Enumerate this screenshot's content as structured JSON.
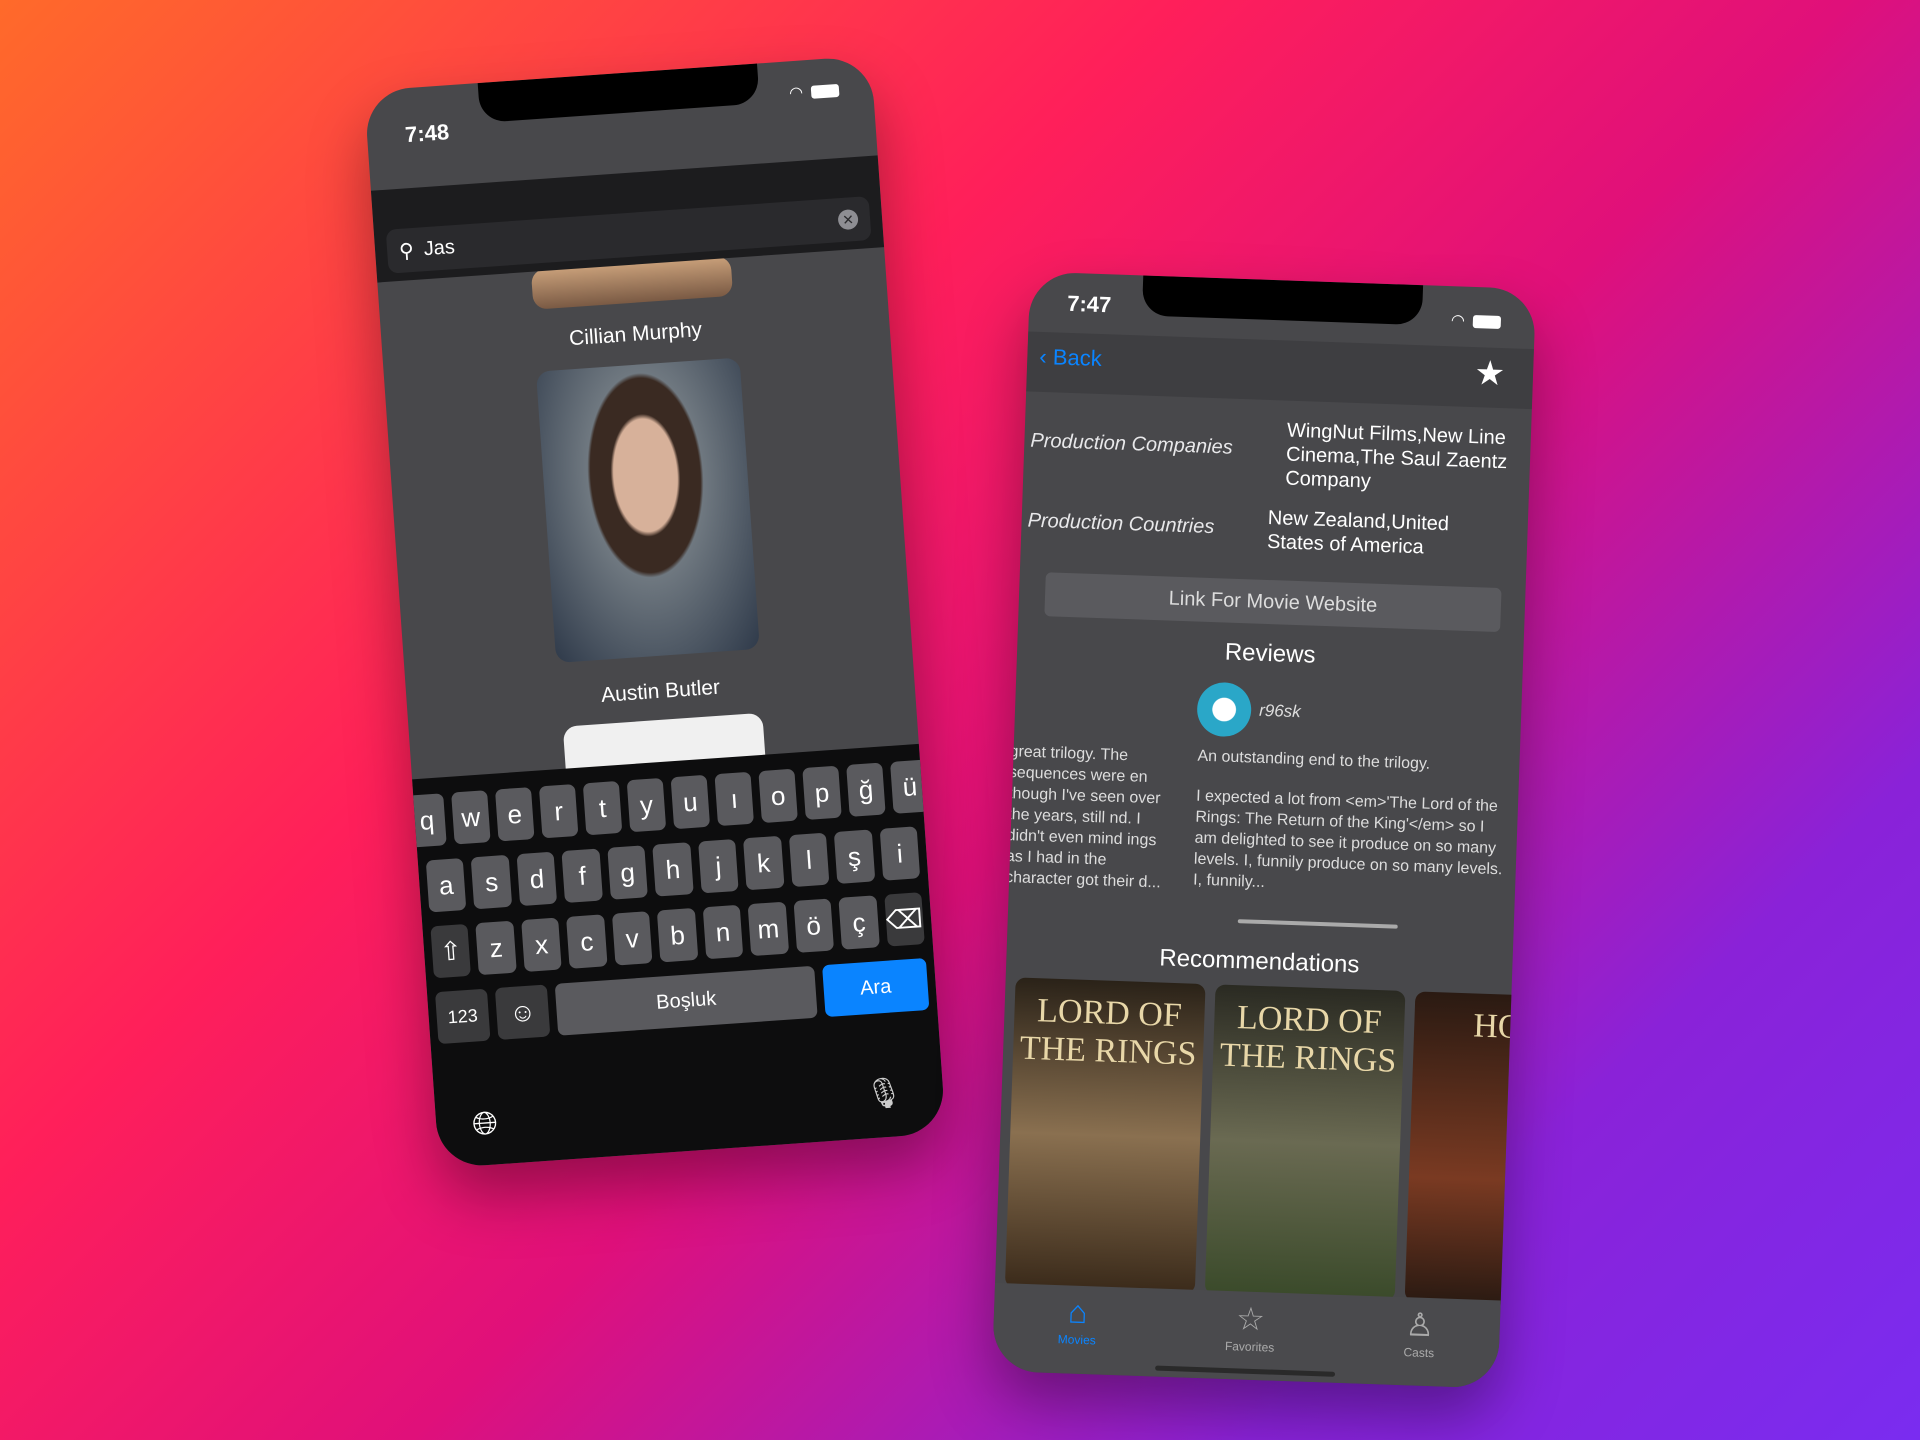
{
  "left_phone": {
    "time": "7:48",
    "search": {
      "value": "Jas"
    },
    "casts": [
      {
        "name": "Cillian Murphy"
      },
      {
        "name": "Austin Butler"
      }
    ],
    "keyboard": {
      "row1": [
        "q",
        "w",
        "e",
        "r",
        "t",
        "y",
        "u",
        "ı",
        "o",
        "p",
        "ğ",
        "ü"
      ],
      "row2": [
        "a",
        "s",
        "d",
        "f",
        "g",
        "h",
        "j",
        "k",
        "l",
        "ş",
        "i"
      ],
      "row3": [
        "z",
        "x",
        "c",
        "v",
        "b",
        "n",
        "m",
        "ö",
        "ç"
      ],
      "numbers": "123",
      "space": "Boşluk",
      "search": "Ara"
    }
  },
  "right_phone": {
    "time": "7:47",
    "back": "Back",
    "production_companies": {
      "label": "Production Companies",
      "value": "WingNut Films,New Line Cinema,The Saul Zaentz Company"
    },
    "production_countries": {
      "label": "Production Countries",
      "value": "New Zealand,United States of America"
    },
    "link_button": "Link For Movie Website",
    "reviews_title": "Reviews",
    "reviews": [
      {
        "text": "great trilogy. The sequences were en though I've seen over the years, still nd. I didn't even mind ings as I had in the character got their d..."
      },
      {
        "author": "r96sk",
        "title": "An outstanding end to the trilogy.",
        "text": "I expected a lot from <em>'The Lord of the Rings: The Return of the King'</em> so I am delighted to see it produce on so many levels. I, funnily produce on so many levels. I, funnily..."
      }
    ],
    "recommendations_title": "Recommendations",
    "recommendations": [
      {
        "title": "LORD OF THE RINGS"
      },
      {
        "title": "LORD OF THE RINGS"
      },
      {
        "title": "HOB"
      }
    ],
    "tabs": [
      {
        "label": "Movies"
      },
      {
        "label": "Favorites"
      },
      {
        "label": "Casts"
      }
    ]
  },
  "colors": {
    "accent": "#0a84ff"
  }
}
